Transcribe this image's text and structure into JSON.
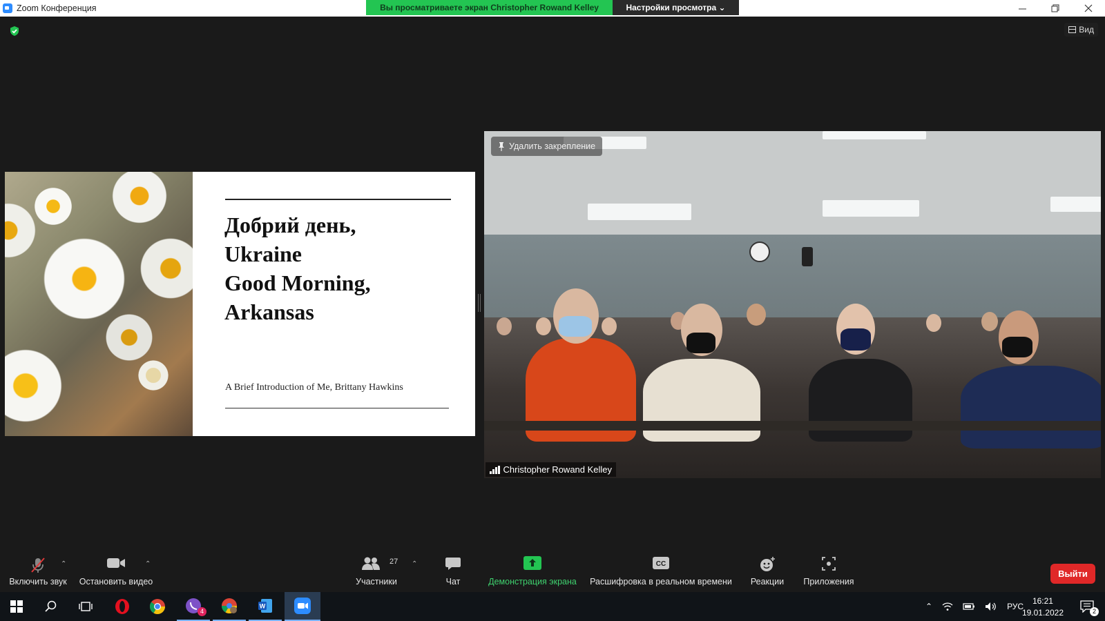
{
  "window": {
    "title": "Zoom Конференция",
    "share_banner": "Вы просматриваете экран Christopher Rowand Kelley",
    "view_settings": "Настройки просмотра"
  },
  "meeting": {
    "view_label": "Вид"
  },
  "slide": {
    "heading_lines": [
      "Добрий день,",
      "Ukraine",
      "Good Morning,",
      "Arkansas"
    ],
    "subtitle": "A Brief Introduction of Me, Brittany Hawkins"
  },
  "video": {
    "unpin_label": "Удалить закрепление",
    "participant_name": "Christopher Rowand Kelley"
  },
  "toolbar": {
    "unmute": "Включить звук",
    "stop_video": "Остановить видео",
    "participants": "Участники",
    "participants_count": "27",
    "chat": "Чат",
    "share_screen": "Демонстрация экрана",
    "live_transcript": "Расшифровка в реальном времени",
    "reactions": "Реакции",
    "apps": "Приложения",
    "leave": "Выйти",
    "accent_green": "#23c552",
    "leave_color": "#e02828"
  },
  "taskbar": {
    "language": "РУС",
    "time": "16:21",
    "date": "19.01.2022",
    "viber_badge": "4",
    "notifications_badge": "2"
  }
}
